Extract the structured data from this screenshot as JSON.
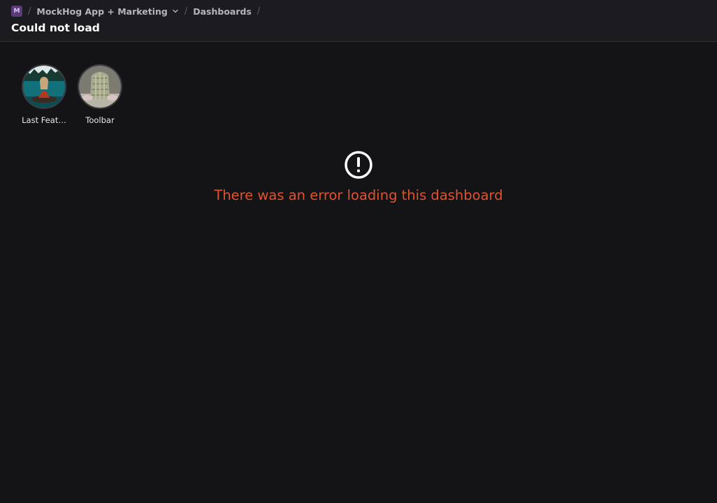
{
  "breadcrumb": {
    "project_badge": "M",
    "separator": "/",
    "project_name": "MockHog App + Marketing",
    "section": "Dashboards"
  },
  "page": {
    "title": "Could not load"
  },
  "stories": [
    {
      "label": "Last Feat…",
      "icon": "woman-in-canoe-photo"
    },
    {
      "label": "Toolbar",
      "icon": "person-sitting-photo"
    }
  ],
  "error": {
    "icon": "exclamation-circle-icon",
    "message": "There was an error loading this dashboard",
    "color": "#e0532e"
  },
  "colors": {
    "background": "#141417",
    "topbar": "#1b1b20",
    "badge": "#5b3a7a"
  }
}
